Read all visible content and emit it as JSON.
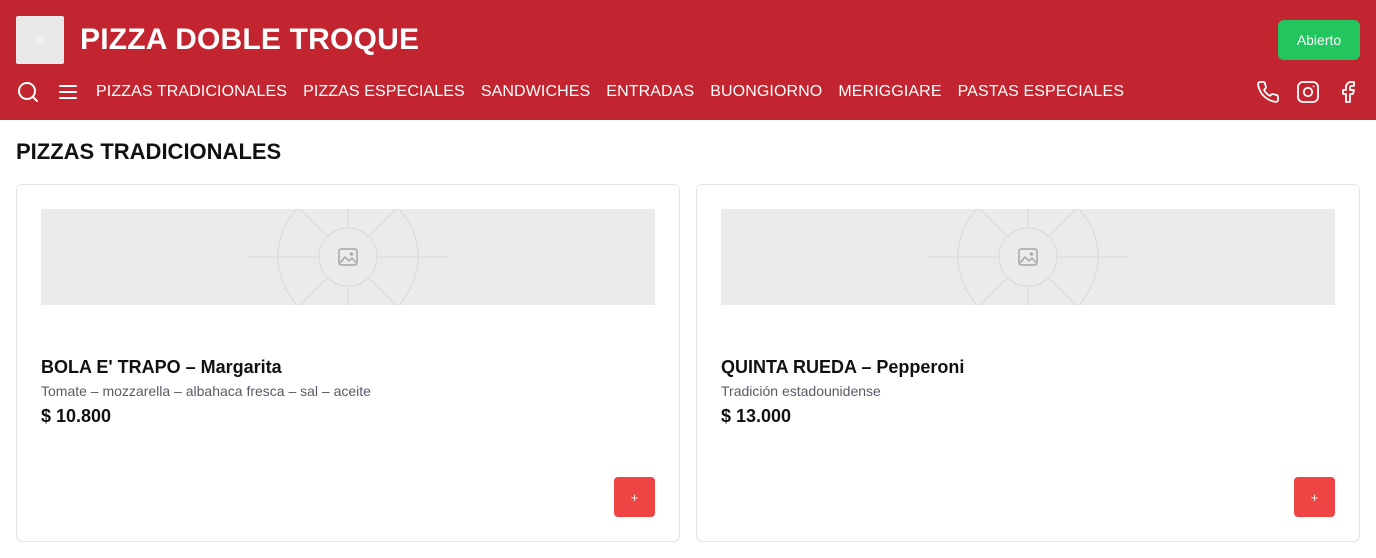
{
  "header": {
    "brand": "PIZZA DOBLE TROQUE",
    "status_label": "Abierto",
    "colors": {
      "background": "#c2252f",
      "status": "#22c55e"
    },
    "icons": [
      "search-icon",
      "menu-icon",
      "phone-icon",
      "instagram-icon",
      "facebook-icon"
    ]
  },
  "nav": {
    "items": [
      {
        "label": "PIZZAS TRADICIONALES"
      },
      {
        "label": "PIZZAS ESPECIALES"
      },
      {
        "label": "SANDWICHES"
      },
      {
        "label": "ENTRADAS"
      },
      {
        "label": "BUONGIORNO"
      },
      {
        "label": "MERIGGIARE"
      },
      {
        "label": "PASTAS ESPECIALES"
      }
    ]
  },
  "section": {
    "title": "PIZZAS TRADICIONALES"
  },
  "products": [
    {
      "name": "BOLA E' TRAPO – Margarita",
      "description": "Tomate – mozzarella – albahaca fresca – sal – aceite",
      "price": "$ 10.800",
      "add_label": "+"
    },
    {
      "name": "QUINTA RUEDA – Pepperoni",
      "description": "Tradición estadounidense",
      "price": "$ 13.000",
      "add_label": "+"
    }
  ],
  "colors": {
    "add_button": "#ef4444"
  }
}
